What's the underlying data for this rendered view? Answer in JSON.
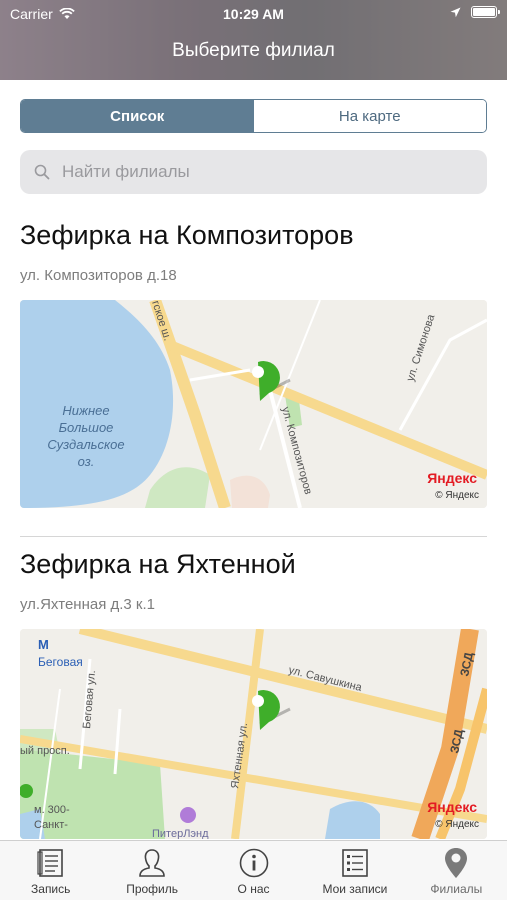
{
  "status_bar": {
    "carrier": "Carrier",
    "time": "10:29 AM"
  },
  "header": {
    "title": "Выберите филиал"
  },
  "view_toggle": {
    "list_label": "Список",
    "map_label": "На карте",
    "selected": "Список"
  },
  "search": {
    "placeholder": "Найти филиалы",
    "value": ""
  },
  "branches": [
    {
      "name": "Зефирка на Композиторов",
      "address": "ул. Композиторов д.18",
      "map": {
        "labels": [
          "Нижнее",
          "Большое",
          "Суздальское",
          "оз.",
          "ул. Композиторов",
          "ул. Симонова",
          "гское ш."
        ],
        "yandex_logo": "Яндекс",
        "copyright": "© Яндекс"
      }
    },
    {
      "name": "Зефирка на Яхтенной",
      "address": "ул.Яхтенная д.3 к.1",
      "map": {
        "labels": [
          "Беговая",
          "Беговая ул.",
          "ул. Савушкина",
          "Яхтенная ул.",
          "ЗСД",
          "ЗСД",
          "ый просп.",
          "м. 300-",
          "Санкт-",
          "ПитерЛэнд"
        ],
        "yandex_logo": "Яндекс",
        "copyright": "© Яндекс"
      }
    }
  ],
  "tab_bar": {
    "items": [
      {
        "label": "Запись",
        "icon": "document-icon"
      },
      {
        "label": "Профиль",
        "icon": "profile-icon"
      },
      {
        "label": "О нас",
        "icon": "info-icon"
      },
      {
        "label": "Мои записи",
        "icon": "list-icon"
      },
      {
        "label": "Филиалы",
        "icon": "location-pin-icon"
      }
    ],
    "active": "Филиалы"
  },
  "colors": {
    "accent": "#5f7d93",
    "marker": "#3fae2a",
    "water": "#aed0ec",
    "road": "#f7d98e",
    "park": "#bfe3b0"
  }
}
